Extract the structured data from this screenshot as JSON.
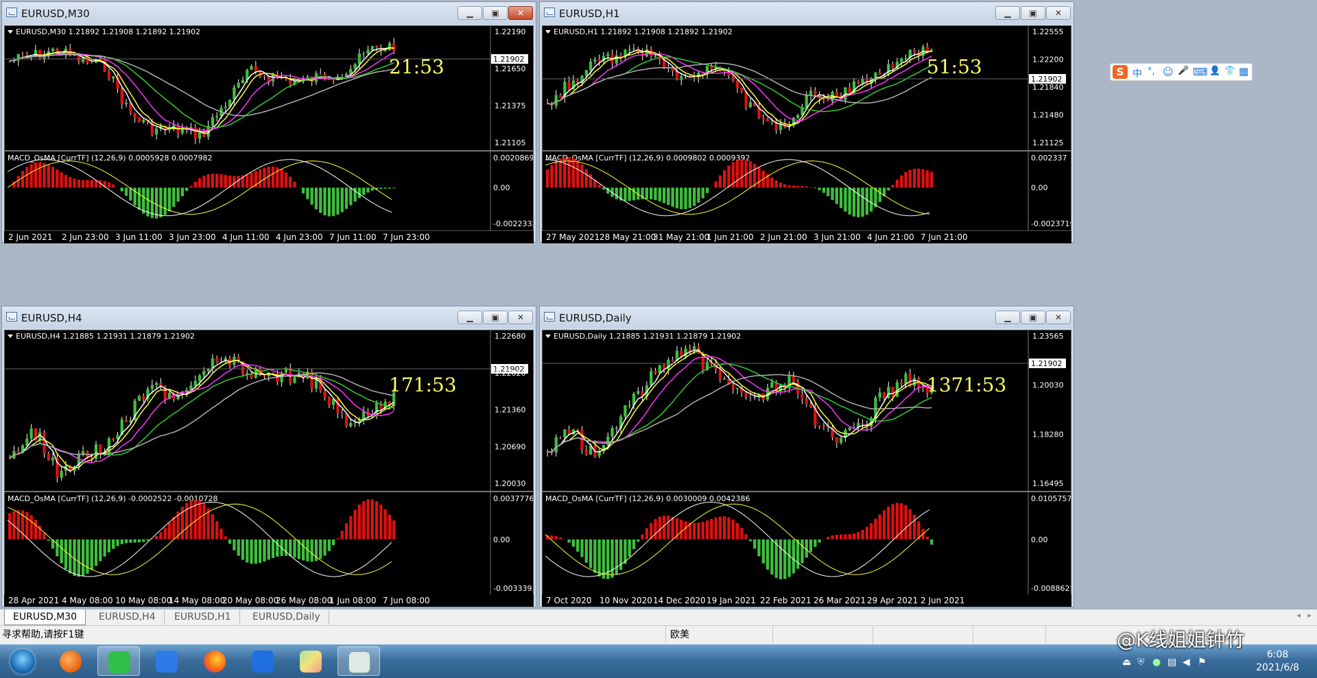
{
  "windows": [
    {
      "title": "EURUSD,M30",
      "close_active": true,
      "header": "EURUSD,M30  1.21892 1.21908 1.21892 1.21902",
      "timer": "21:53",
      "price_tag": "1.21902",
      "price_axis": [
        "1.22190",
        "1.21650",
        "1.21375",
        "1.21105"
      ],
      "macd_label": "MACD_OsMA [CurrTF] (12,26,9) 0.0005928 0.0007982",
      "macd_axis": [
        "0.0020869",
        "0.00",
        "-0.0022332"
      ],
      "time_axis": [
        "2 Jun 2021",
        "2 Jun 23:00",
        "3 Jun 11:00",
        "3 Jun 23:00",
        "4 Jun 11:00",
        "4 Jun 23:00",
        "7 Jun 11:00",
        "7 Jun 23:00"
      ]
    },
    {
      "title": "EURUSD,H1",
      "close_active": false,
      "header": "EURUSD,H1  1.21892 1.21908 1.21892 1.21902",
      "timer": "51:53",
      "price_tag": "1.21902",
      "price_axis": [
        "1.22555",
        "1.22200",
        "1.21840",
        "1.21480",
        "1.21125"
      ],
      "macd_label": "MACD_OsMA [CurrTF] (12,26,9) 0.0009802 0.0009392",
      "macd_axis": [
        "0.002337",
        "0.00",
        "-0.0023719"
      ],
      "time_axis": [
        "27 May 2021",
        "28 May 21:00",
        "31 May 21:00",
        "1 Jun 21:00",
        "2 Jun 21:00",
        "3 Jun 21:00",
        "4 Jun 21:00",
        "7 Jun 21:00"
      ]
    },
    {
      "title": "EURUSD,H4",
      "close_active": false,
      "header": "EURUSD,H4  1.21885 1.21931 1.21879 1.21902",
      "timer": "171:53",
      "price_tag": "1.21902",
      "price_axis": [
        "1.22680",
        "1.22020",
        "1.21360",
        "1.20690",
        "1.20030"
      ],
      "macd_label": "MACD_OsMA [CurrTF] (12,26,9) -0.0002522 -0.0010728",
      "macd_axis": [
        "0.0037776",
        "0.00",
        "-0.0033393"
      ],
      "time_axis": [
        "28 Apr 2021",
        "4 May 08:00",
        "10 May 08:00",
        "14 May 08:00",
        "20 May 08:00",
        "26 May 08:00",
        "1 Jun 08:00",
        "7 Jun 08:00"
      ]
    },
    {
      "title": "EURUSD,Daily",
      "close_active": false,
      "header": "EURUSD,Daily  1.21885 1.21931 1.21879 1.21902",
      "timer": "1371:53",
      "price_tag": "1.21902",
      "price_axis": [
        "1.23565",
        "1.20030",
        "1.18280",
        "1.16495"
      ],
      "macd_label": "MACD_OsMA [CurrTF] (12,26,9) 0.0030009 0.0042386",
      "macd_axis": [
        "0.0105757",
        "0.00",
        "-0.0088625"
      ],
      "time_axis": [
        "7 Oct 2020",
        "10 Nov 2020",
        "14 Dec 2020",
        "19 Jan 2021",
        "22 Feb 2021",
        "26 Mar 2021",
        "29 Apr 2021",
        "2 Jun 2021"
      ]
    }
  ],
  "tabs": [
    "EURUSD,M30",
    "EURUSD,H4",
    "EURUSD,H1",
    "EURUSD,Daily"
  ],
  "active_tab": 0,
  "status": {
    "help": "寻求帮助,请按F1键",
    "profile": "欧美"
  },
  "ime_bar": {
    "items": [
      "S",
      "中",
      "°,",
      "☺",
      "🎤",
      "⌨",
      "👤",
      "👕",
      "▦"
    ]
  },
  "taskbar": {
    "apps": [
      "start-orb-icon",
      "browser-orb-icon",
      "wechat-icon",
      "pen-note-icon",
      "firefox-icon",
      "meeting-icon",
      "maps-icon",
      "mt4-terminal-icon"
    ],
    "clock_time": "6:08",
    "clock_date": "2021/6/8"
  },
  "watermark": "@K线姐姐钟竹",
  "colors": {
    "bull": "#3fbf3f",
    "bear": "#d11",
    "ma_white": "#ffffff",
    "ma_yellow": "#ffff33",
    "ma_magenta": "#ff33ff",
    "ma_green": "#33cc33",
    "ma_gray": "#b0b0b0",
    "timer": "#ffff66"
  }
}
